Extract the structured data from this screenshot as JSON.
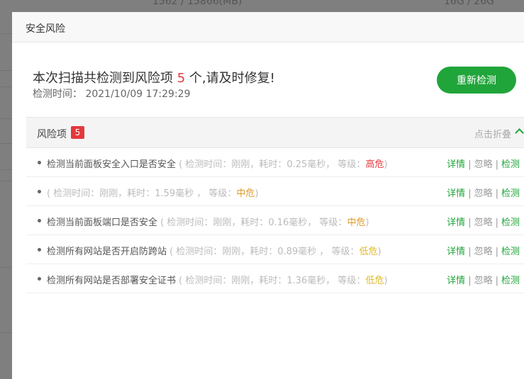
{
  "background": {
    "text_left": "1562 / 15866(MB)",
    "text_right": "16G / 26G"
  },
  "modal": {
    "title": "安全风险"
  },
  "summary": {
    "prefix": "本次扫描共检测到风险项 ",
    "count": "5",
    "suffix": " 个,请及时修复!",
    "time_label": "检测时间：",
    "time_value": "2021/10/09 17:29:29",
    "rescan_label": "重新检测"
  },
  "panel": {
    "title": "风险项",
    "badge": "5",
    "collapse_label": "点击折叠"
  },
  "rows": [
    {
      "name": "检测当前面板安全入口是否安全",
      "open": " ( 检测时间：刚刚，耗时：0.25毫秒， 等级：",
      "level": "高危",
      "close": ")"
    },
    {
      "name": "",
      "open": " ( 检测时间：刚刚，耗时：1.59毫秒 ， 等级：",
      "level": "中危",
      "close": ")"
    },
    {
      "name": "检测当前面板端口是否安全",
      "open": " ( 检测时间：刚刚，耗时：0.16毫秒， 等级：",
      "level": "中危",
      "close": ")"
    },
    {
      "name": "检测所有网站是否开启防跨站",
      "open": " ( 检测时间：刚刚，耗时：0.89毫秒 ， 等级：",
      "level": "低危",
      "close": ")"
    },
    {
      "name": "检测所有网站是否部署安全证书",
      "open": " ( 检测时间：刚刚，耗时：1.36毫秒， 等级：",
      "level": "低危",
      "close": ")"
    }
  ],
  "actions": {
    "detail": "详情",
    "ignore": "忽略",
    "check": "检测",
    "separator": "|"
  },
  "colors": {
    "accent": "#20a53a",
    "high": "#e4393c",
    "medium": "#e09b2b",
    "low": "#e0b92c"
  }
}
